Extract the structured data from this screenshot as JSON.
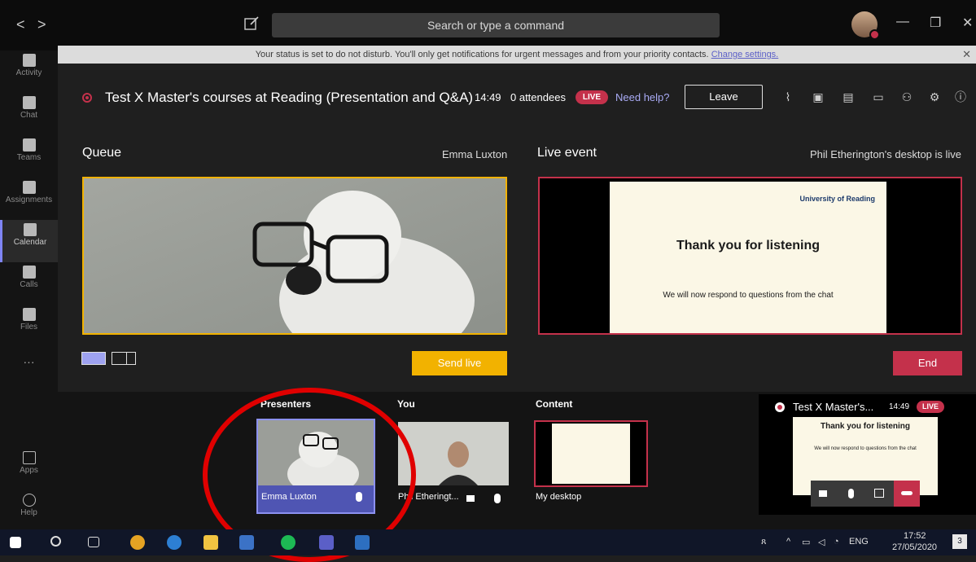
{
  "titlebar": {
    "back_glyph": "<",
    "forward_glyph": ">",
    "search_placeholder": "Search or type a command",
    "minimize_glyph": "—",
    "maximize_glyph": "❐",
    "close_glyph": "✕"
  },
  "rail": {
    "items": [
      {
        "label": "Activity",
        "icon": "bell-icon"
      },
      {
        "label": "Chat",
        "icon": "chat-icon"
      },
      {
        "label": "Teams",
        "icon": "teams-icon"
      },
      {
        "label": "Assignments",
        "icon": "assignments-icon"
      },
      {
        "label": "Calendar",
        "icon": "calendar-icon",
        "active": true
      },
      {
        "label": "Calls",
        "icon": "phone-icon"
      },
      {
        "label": "Files",
        "icon": "file-icon"
      }
    ],
    "more_glyph": "···",
    "apps_label": "Apps",
    "help_label": "Help"
  },
  "notice": {
    "text": "Your status is set to do not disturb. You'll only get notifications for urgent messages and from your priority contacts.",
    "link": "Change settings.",
    "close_glyph": "✕"
  },
  "meeting": {
    "title": "Test X Master's courses at Reading (Presentation and Q&A)",
    "time": "14:49",
    "attendees": "0 attendees",
    "live_badge": "LIVE",
    "need_help": "Need help?",
    "leave_label": "Leave"
  },
  "queue": {
    "title": "Queue",
    "presenter": "Emma Luxton",
    "send_live_label": "Send live"
  },
  "live_event": {
    "title": "Live event",
    "status": "Phil Etherington's desktop is live",
    "end_label": "End",
    "slide_logo": "University of Reading",
    "slide_title": "Thank you for listening",
    "slide_sub": "We will now respond to questions from the chat"
  },
  "sources": {
    "presenters_head": "Presenters",
    "you_head": "You",
    "content_head": "Content",
    "presenter_name": "Emma Luxton",
    "you_name": "Phil Etheringt...",
    "content_name": "My desktop"
  },
  "mini": {
    "title": "Test X Master's...",
    "time": "14:49",
    "live_badge": "LIVE",
    "slide_title": "Thank you for listening",
    "slide_sub": "We will now respond to questions from the chat"
  },
  "taskbar": {
    "lang": "ENG",
    "time": "17:52",
    "date": "27/05/2020",
    "notifications": "3"
  },
  "colors": {
    "accent": "#7f85f5",
    "live_red": "#c4314b",
    "queue_yellow": "#f2b200",
    "highlight_circle": "#e00000"
  }
}
